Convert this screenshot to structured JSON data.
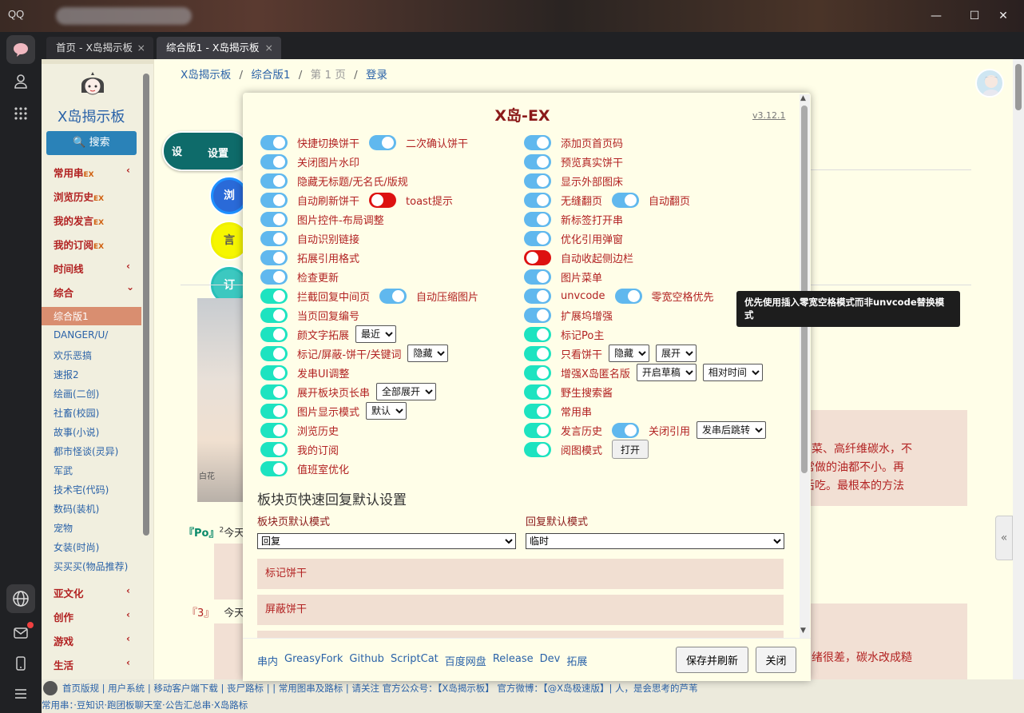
{
  "window": {
    "app_name": "QQ",
    "minimize": "—",
    "maximize": "☐",
    "close": "✕"
  },
  "tabs": [
    {
      "label": "首页 - X岛揭示板",
      "close": "×"
    },
    {
      "label": "综合版1 - X岛揭示板",
      "close": "×"
    }
  ],
  "breadcrumb": {
    "site": "X岛揭示板",
    "board": "综合版1",
    "page": "第 1 页",
    "login": "登录",
    "sep": "/"
  },
  "sidebar": {
    "title": "X岛揭示板",
    "search_label": "搜索",
    "main_items": [
      {
        "label": "常用串",
        "ex": "EX",
        "chevron": "‹"
      },
      {
        "label": "浏览历史",
        "ex": "EX"
      },
      {
        "label": "我的发言",
        "ex": "EX"
      },
      {
        "label": "我的订阅",
        "ex": "EX"
      },
      {
        "label": "时间线",
        "chevron": "‹"
      },
      {
        "label": "综合",
        "chevron": "⌄"
      }
    ],
    "active_board": "综合版1",
    "boards": [
      "DANGER/U/",
      "欢乐恶搞",
      "速报2",
      "绘画(二创)",
      "社畜(校园)",
      "故事(小说)",
      "都市怪谈(灵异)",
      "军武",
      "技术宅(代码)",
      "数码(装机)",
      "宠物",
      "女装(时尚)",
      "买买买(物品推荐)"
    ],
    "groups": [
      {
        "label": "亚文化",
        "chevron": "‹"
      },
      {
        "label": "创作",
        "chevron": "‹"
      },
      {
        "label": "游戏",
        "chevron": "‹"
      },
      {
        "label": "生活",
        "chevron": "‹"
      }
    ]
  },
  "float_menu": {
    "settings_circle": "设",
    "settings_label": "设置",
    "c1": "浏",
    "c2": "言",
    "c3": "订"
  },
  "background": {
    "po_label": "『Po』",
    "po_sup": "2",
    "po_text": "今天",
    "num3": "『3』",
    "num3_text": "今天",
    "image_caption": "白花",
    "text1": "菜、高纤维碳水，不",
    "text2": "常做的油都不小。再",
    "text3": "后吃。最根本的方法",
    "text4": "绪很差，碳水改成糙",
    "collapse": "«"
  },
  "modal": {
    "title": "X岛-EX",
    "version": "v3.12.1",
    "left_rows": [
      {
        "items": [
          {
            "label": "快捷切换饼干",
            "toggle": "on"
          },
          {
            "label": "二次确认饼干",
            "toggle": "on"
          }
        ]
      },
      {
        "items": [
          {
            "label": "关闭图片水印",
            "toggle": "on"
          }
        ]
      },
      {
        "items": [
          {
            "label": "隐藏无标题/无名氏/版规",
            "toggle": "on"
          }
        ]
      },
      {
        "items": [
          {
            "label": "自动刷新饼干",
            "toggle": "on"
          },
          {
            "label": "toast提示",
            "toggle": "off"
          }
        ]
      },
      {
        "items": [
          {
            "label": "图片控件-布局调整",
            "toggle": "on"
          }
        ]
      },
      {
        "items": [
          {
            "label": "自动识别链接",
            "toggle": "on"
          }
        ]
      },
      {
        "items": [
          {
            "label": "拓展引用格式",
            "toggle": "on"
          }
        ]
      },
      {
        "items": [
          {
            "label": "检查更新",
            "toggle": "on"
          }
        ]
      },
      {
        "items": [
          {
            "label": "拦截回复中间页",
            "toggle": "teal"
          },
          {
            "label": "自动压缩图片",
            "toggle": "on"
          }
        ]
      },
      {
        "items": [
          {
            "label": "当页回复编号",
            "toggle": "teal"
          }
        ]
      },
      {
        "items": [
          {
            "label": "颜文字拓展",
            "toggle": "teal"
          }
        ],
        "selects": [
          "最近"
        ]
      },
      {
        "items": [
          {
            "label": "标记/屏蔽-饼干/关键词",
            "toggle": "teal"
          }
        ],
        "selects": [
          "隐藏"
        ]
      },
      {
        "items": [
          {
            "label": "发串UI调整",
            "toggle": "teal"
          }
        ]
      },
      {
        "items": [
          {
            "label": "展开板块页长串",
            "toggle": "teal"
          }
        ],
        "selects": [
          "全部展开"
        ]
      },
      {
        "items": [
          {
            "label": "图片显示模式",
            "toggle": "teal"
          }
        ],
        "selects": [
          "默认"
        ]
      },
      {
        "items": [
          {
            "label": "浏览历史",
            "toggle": "teal"
          }
        ]
      },
      {
        "items": [
          {
            "label": "我的订阅",
            "toggle": "teal"
          }
        ]
      },
      {
        "items": [
          {
            "label": "值班室优化",
            "toggle": "teal"
          }
        ]
      }
    ],
    "right_rows": [
      {
        "items": [
          {
            "label": "添加页首页码",
            "toggle": "on"
          }
        ]
      },
      {
        "items": [
          {
            "label": "预览真实饼干",
            "toggle": "on"
          }
        ]
      },
      {
        "items": [
          {
            "label": "显示外部图床",
            "toggle": "on"
          }
        ]
      },
      {
        "items": [
          {
            "label": "无缝翻页",
            "toggle": "on"
          },
          {
            "label": "自动翻页",
            "toggle": "on"
          }
        ]
      },
      {
        "items": [
          {
            "label": "新标签打开串",
            "toggle": "on"
          }
        ]
      },
      {
        "items": [
          {
            "label": "优化引用弹窗",
            "toggle": "on"
          }
        ]
      },
      {
        "items": [
          {
            "label": "自动收起侧边栏",
            "toggle": "off"
          }
        ]
      },
      {
        "items": [
          {
            "label": "图片菜单",
            "toggle": "on"
          }
        ]
      },
      {
        "items": [
          {
            "label": "unvcode",
            "toggle": "on"
          },
          {
            "label": "零宽空格优先",
            "toggle": "on"
          }
        ]
      },
      {
        "items": [
          {
            "label": "扩展坞增强",
            "toggle": "on"
          }
        ]
      },
      {
        "items": [
          {
            "label": "标记Po主",
            "toggle": "teal"
          }
        ]
      },
      {
        "items": [
          {
            "label": "只看饼干",
            "toggle": "teal"
          }
        ],
        "selects": [
          "隐藏",
          "展开"
        ]
      },
      {
        "items": [
          {
            "label": "增强X岛匿名版",
            "toggle": "teal"
          }
        ],
        "selects": [
          "开启草稿",
          "相对时间"
        ]
      },
      {
        "items": [
          {
            "label": "野生搜索酱",
            "toggle": "teal"
          }
        ]
      },
      {
        "items": [
          {
            "label": "常用串",
            "toggle": "teal"
          }
        ]
      },
      {
        "items": [
          {
            "label": "发言历史",
            "toggle": "teal"
          },
          {
            "label": "关闭引用",
            "toggle": "on"
          }
        ],
        "selects": [
          "发串后跳转"
        ]
      },
      {
        "items": [
          {
            "label": "阅图模式",
            "toggle": "teal"
          }
        ],
        "button": "打开"
      }
    ],
    "section_title": "板块页快速回复默认设置",
    "board_mode_label": "板块页默认模式",
    "board_mode_value": "回复",
    "reply_mode_label": "回复默认模式",
    "reply_mode_value": "临时",
    "mark_cookie": "标记饼干",
    "block_cookie": "屏蔽饼干",
    "footer_links": [
      "串内",
      "GreasyFork",
      "Github",
      "ScriptCat",
      "百度网盘",
      "Release",
      "Dev",
      "拓展"
    ],
    "save_button": "保存并刷新",
    "close_button": "关闭"
  },
  "tooltip": "优先使用插入零宽空格模式而非unvcode替换模式",
  "footer": {
    "line1": "首页版规 | 用户系统 | 移动客户端下载 | 丧尸路标 | | 常用图串及路标 | 请关注 官方公众号：【X岛揭示板】 官方微博：【@X岛极速版】| 人，是会思考的芦苇",
    "line2": "常用串：·豆知识·跑团板聊天室·公告汇总串·X岛路标"
  },
  "colors": {
    "accent_red": "#b22222",
    "link_blue": "#2a62a8",
    "toggle_blue": "#60b8ee",
    "toggle_teal": "#1de3c0",
    "toggle_off": "#dd1111"
  }
}
